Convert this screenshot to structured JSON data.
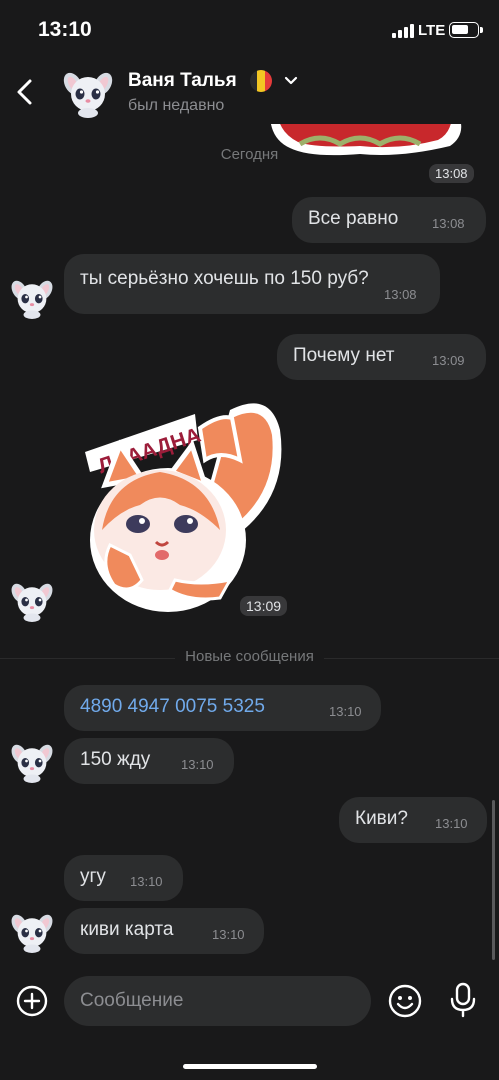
{
  "status_bar": {
    "time": "13:10",
    "network": "LTE"
  },
  "header": {
    "contact_name": "Ваня Талья",
    "contact_status": "был недавно",
    "flag_colors": [
      "#2b2b2b",
      "#f3c623",
      "#e53b3b"
    ]
  },
  "chat": {
    "top_sticker_time": "13:08",
    "date_separator": "Сегодня",
    "new_messages_label": "Новые сообщения",
    "sticker": {
      "caption": "ЛАААДНА",
      "time": "13:09"
    },
    "messages": [
      {
        "side": "out",
        "text": "Все равно",
        "time": "13:08"
      },
      {
        "side": "in",
        "text": "ты серьёзно хочешь по 150 руб?",
        "time": "13:08"
      },
      {
        "side": "out",
        "text": "Почему нет",
        "time": "13:09"
      },
      {
        "side": "in",
        "text": "4890 4947 0075 5325",
        "time": "13:10"
      },
      {
        "side": "in",
        "text": "150 жду",
        "time": "13:10"
      },
      {
        "side": "out",
        "text": "Киви?",
        "time": "13:10"
      },
      {
        "side": "in",
        "text": "угу",
        "time": "13:10"
      },
      {
        "side": "in",
        "text": "киви карта",
        "time": "13:10"
      }
    ]
  },
  "composer": {
    "placeholder": "Сообщение"
  },
  "colors": {
    "background": "#19191a",
    "bubble": "#2c2d2e",
    "link": "#71aaeb",
    "text": "#e1e3e6",
    "muted": "#8c8d91"
  }
}
